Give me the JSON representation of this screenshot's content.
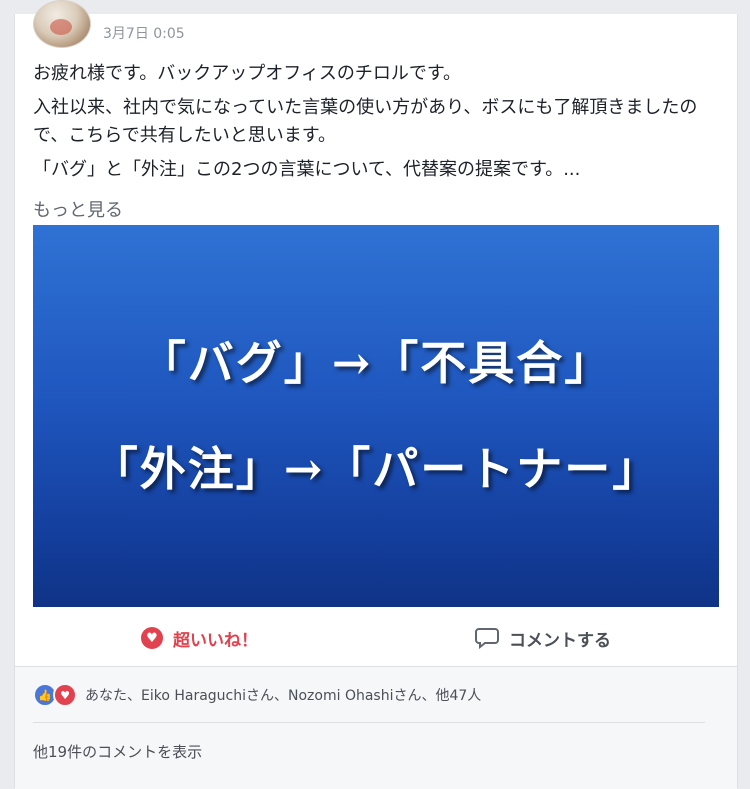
{
  "post": {
    "timestamp": "3月7日 0:05",
    "paragraphs": [
      "お疲れ様です。バックアップオフィスのチロルです。",
      "入社以来、社内で気になっていた言葉の使い方があり、ボスにも了解頂きましたので、こちらで共有したいと思います。",
      "「バグ」と「外注」この2つの言葉について、代替案の提案です。..."
    ],
    "see_more": "もっと見る",
    "image_text": {
      "line1": "「バグ」→「不具合」",
      "line2": "「外注」→「パートナー」"
    }
  },
  "actions": {
    "like_label": "超いいね！",
    "comment_label": "コメントする"
  },
  "reactions": {
    "summary": "あなた、Eiko Haraguchiさん、Nozomi Ohashiさん、他47人"
  },
  "comments": {
    "more_label": "他19件のコメントを表示"
  },
  "colors": {
    "like_accent": "#e0434f",
    "thumb_blue": "#4a78d8",
    "image_blue_top": "#2f72d4",
    "image_blue_bottom": "#0f3386"
  },
  "icons": [
    "avatar",
    "heart-icon",
    "comment-bubble-icon",
    "like-thumb-icon",
    "love-reaction-icon"
  ]
}
